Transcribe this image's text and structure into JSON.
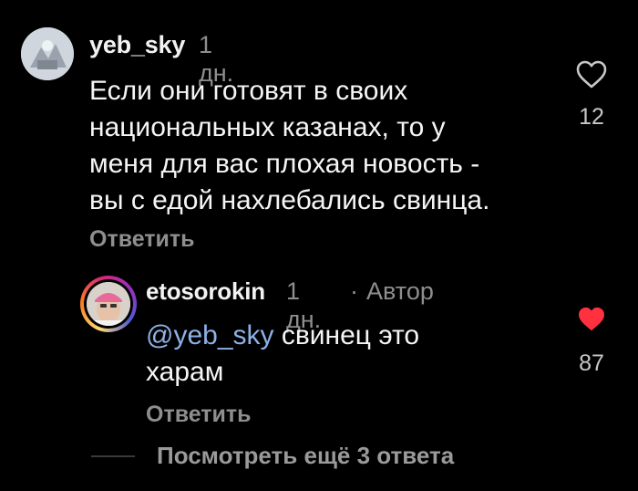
{
  "comments": [
    {
      "username": "yeb_sky",
      "time": "1 дн.",
      "text_lines": [
        "Если они готовят в своих",
        "национальных казанах, то у",
        "меня для вас плохая новость -",
        "вы с едой нахлебались свинца."
      ],
      "reply_label": "Ответить",
      "likes": "12",
      "liked": false
    },
    {
      "username": "etosorokin",
      "time": "1 дн.",
      "separator": "·",
      "author_badge": "Автор",
      "mention": "@yeb_sky",
      "text_rest": " свинец это",
      "text_line2": "харам",
      "reply_label": "Ответить",
      "likes": "87",
      "liked": true
    }
  ],
  "view_more": "Посмотреть ещё 3 ответа",
  "colors": {
    "background": "#000000",
    "heart_liked": "#ff3040",
    "mention": "#8db2e6",
    "secondary_text": "#8e8e8e"
  },
  "icons": {
    "like_outline": "heart-outline-icon",
    "like_filled": "heart-filled-icon"
  }
}
